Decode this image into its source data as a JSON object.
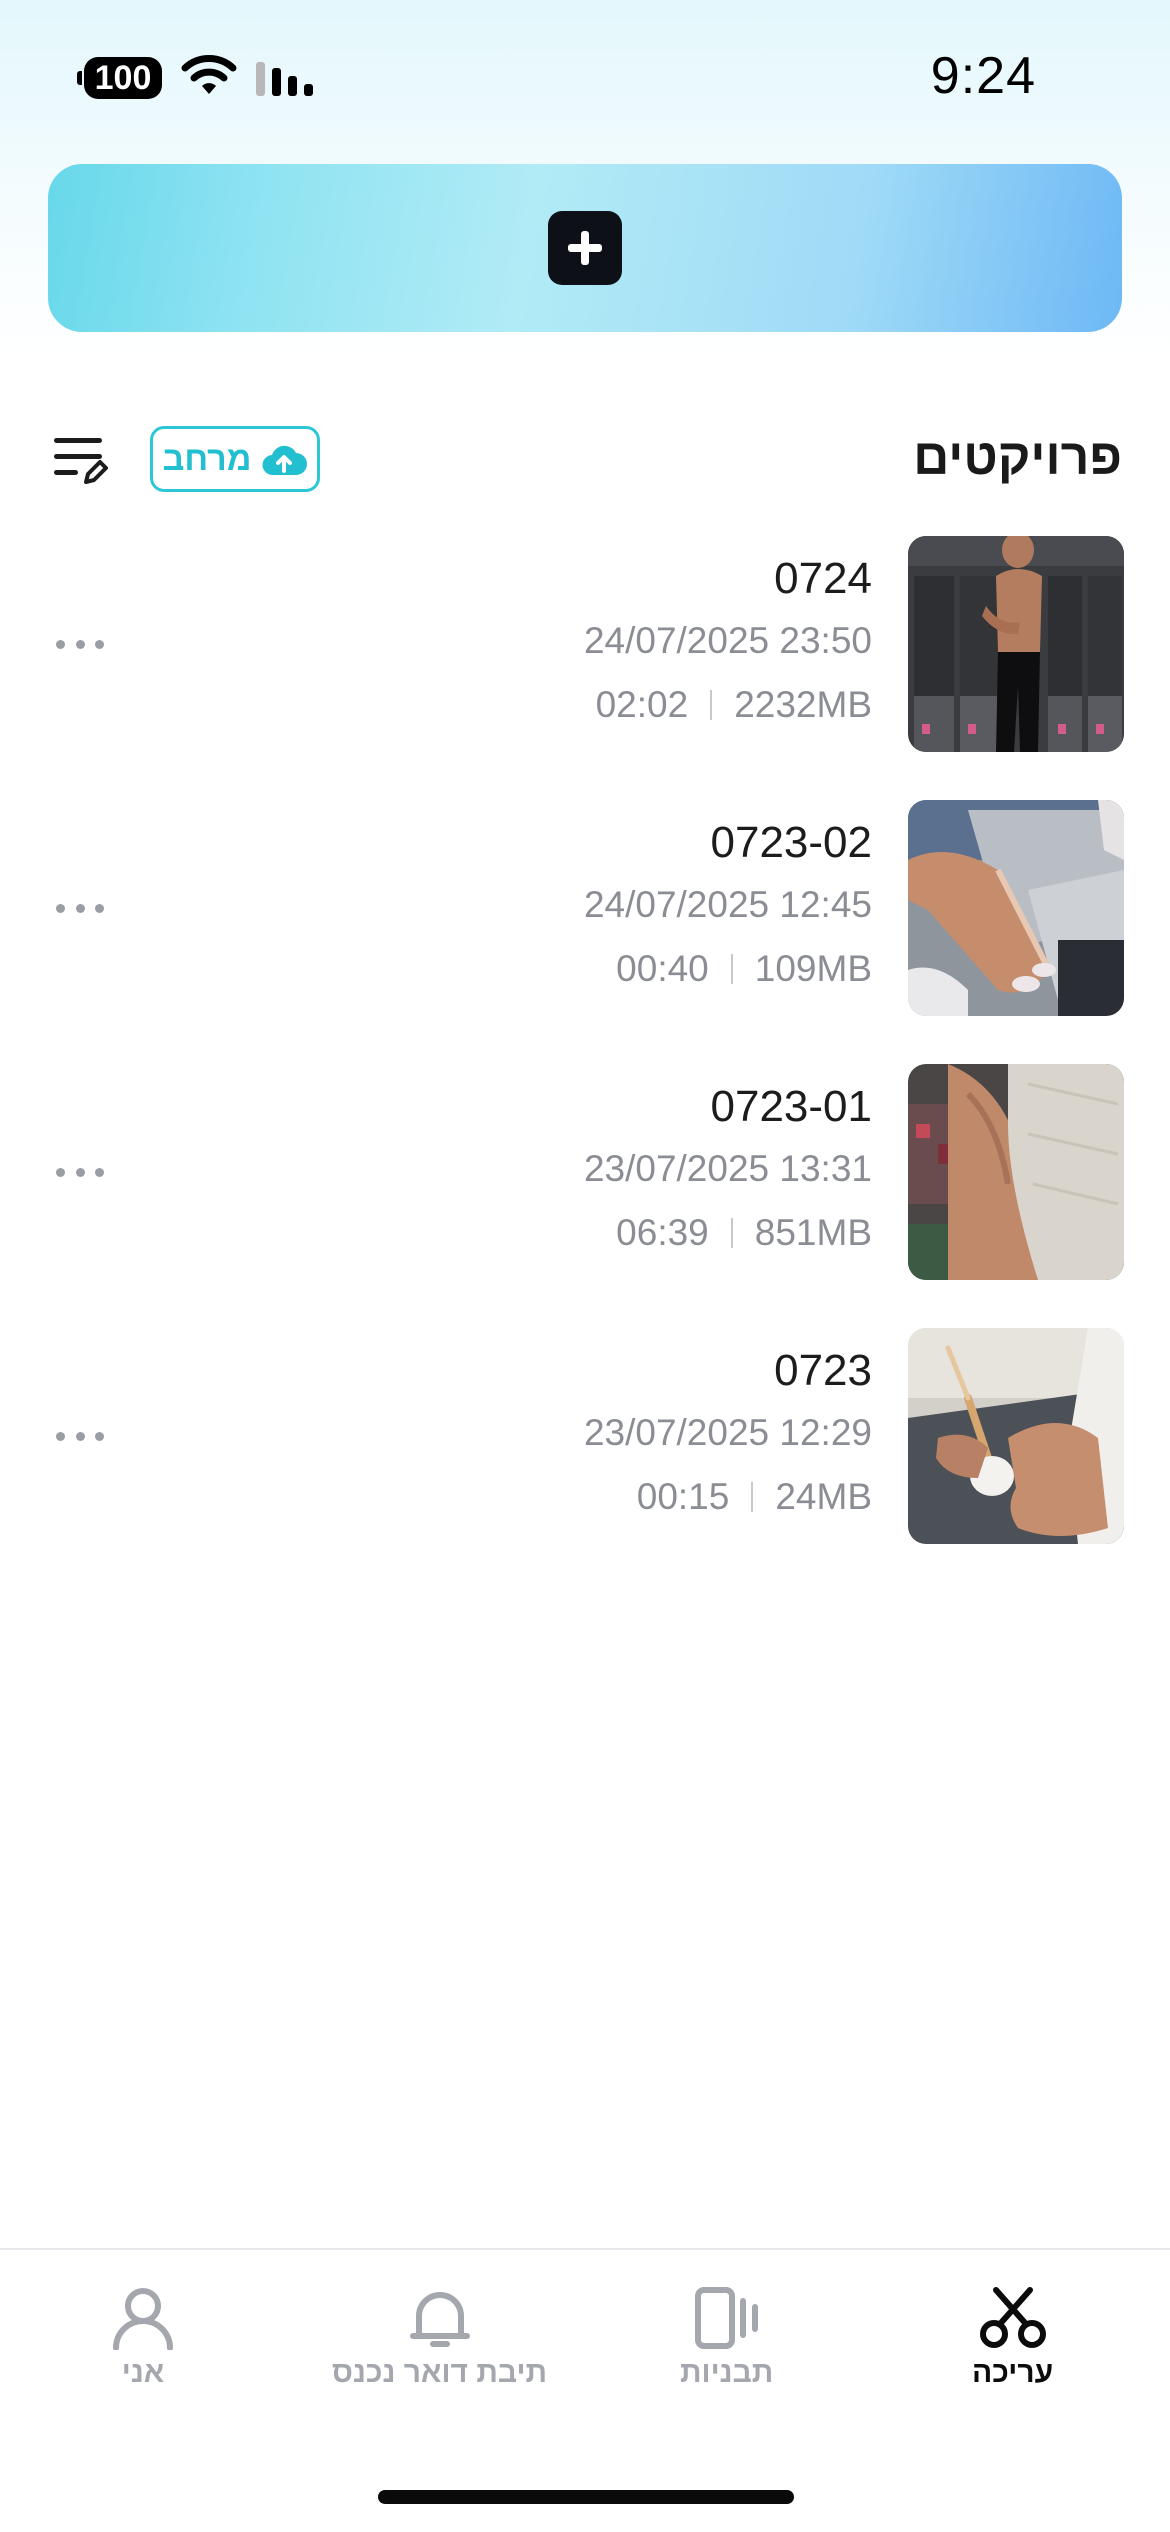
{
  "status_bar": {
    "time": "9:24",
    "battery": "100"
  },
  "create_button": {
    "icon": "plus-icon"
  },
  "projects_section": {
    "title": "פרויקטים",
    "space_chip_label": "מרחב",
    "space_chip_icon": "cloud-upload-icon",
    "edit_list_icon": "list-edit-icon"
  },
  "projects": [
    {
      "title": "0724",
      "datetime": "24/07/2025 23:50",
      "duration": "02:02",
      "size": "2232MB"
    },
    {
      "title": "0723-02",
      "datetime": "24/07/2025 12:45",
      "duration": "00:40",
      "size": "109MB"
    },
    {
      "title": "0723-01",
      "datetime": "23/07/2025 13:31",
      "duration": "06:39",
      "size": "851MB"
    },
    {
      "title": "0723",
      "datetime": "23/07/2025 12:29",
      "duration": "00:15",
      "size": "24MB"
    }
  ],
  "tab_bar": {
    "edit": "עריכה",
    "templates": "תבניות",
    "inbox": "תיבת דואר נכנס",
    "me": "אני"
  },
  "colors": {
    "accent": "#22bfd0",
    "active_tab": "#0b0b0b",
    "inactive_tab": "#a4a7ad"
  }
}
